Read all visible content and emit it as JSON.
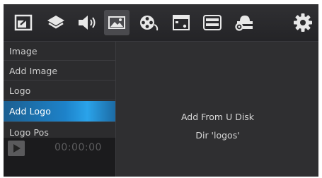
{
  "toolbar": {
    "icons": [
      {
        "name": "picture-in-picture-icon",
        "active": false
      },
      {
        "name": "layers-icon",
        "active": false
      },
      {
        "name": "speaker-icon",
        "active": false
      },
      {
        "name": "image-icon",
        "active": true
      },
      {
        "name": "film-reel-icon",
        "active": false
      },
      {
        "name": "screen-window-icon",
        "active": false
      },
      {
        "name": "hdmi-port-icon",
        "active": false
      },
      {
        "name": "network-gear-icon",
        "active": false
      },
      {
        "name": "settings-gear-icon",
        "active": false
      }
    ]
  },
  "menu": {
    "items": [
      {
        "label": "Image"
      },
      {
        "label": "Add Image"
      },
      {
        "label": "Logo"
      },
      {
        "label": "Add Logo",
        "selected": true
      },
      {
        "label": "Logo Pos"
      }
    ]
  },
  "player": {
    "time": "00:00:00"
  },
  "content": {
    "line1": "Add From U Disk",
    "line2": "Dir 'logos'"
  },
  "colors": {
    "accent": "#1d82c9",
    "background": "#2a2a2c"
  }
}
